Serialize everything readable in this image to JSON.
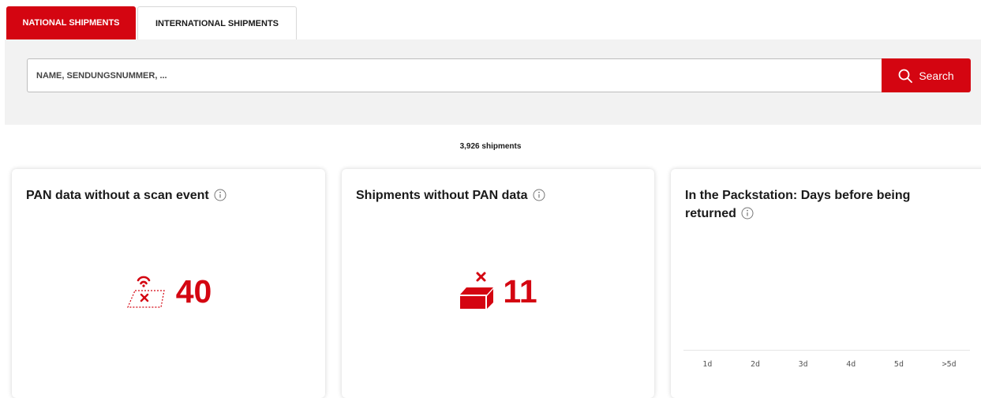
{
  "tabs": [
    {
      "label": "NATIONAL SHIPMENTS",
      "active": true
    },
    {
      "label": "INTERNATIONAL SHIPMENTS",
      "active": false
    }
  ],
  "search": {
    "placeholder": "NAME, SENDUNGSNUMMER, ...",
    "button_label": "Search"
  },
  "summary": {
    "count_text": "3,926 shipments"
  },
  "cards": [
    {
      "title": "PAN data without a scan event",
      "value": "40",
      "icon": "no-scan-parcel-icon"
    },
    {
      "title": "Shipments without PAN data",
      "value": "11",
      "icon": "parcel-missing-icon"
    },
    {
      "title": "In the Packstation: Days before being returned",
      "icon": "info-icon"
    }
  ],
  "chart_data": {
    "type": "bar",
    "title": "In the Packstation: Days before being returned",
    "categories": [
      "1d",
      "2d",
      "3d",
      "4d",
      "5d",
      ">5d"
    ],
    "values": []
  },
  "colors": {
    "accent": "#d40511",
    "panel": "#f2f2f2"
  }
}
